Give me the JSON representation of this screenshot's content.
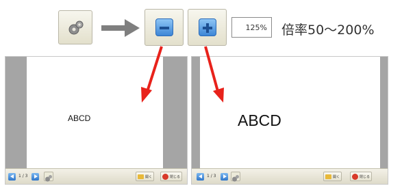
{
  "toolbar": {
    "zoom_value": "125%",
    "zoom_caption": "倍率50～200%"
  },
  "icons": {
    "settings": "gear-icon",
    "arrow": "arrow-right-icon",
    "zoom_out": "minus-icon",
    "zoom_in": "plus-icon",
    "pointers": "red-arrow-icon"
  },
  "preview_small": {
    "text": "ABCD",
    "page_indicator": "1 / 3",
    "open_label": "開く",
    "close_label": "閉じる"
  },
  "preview_large": {
    "text": "ABCD",
    "page_indicator": "1 / 3",
    "open_label": "開く",
    "close_label": "閉じる"
  },
  "colors": {
    "pointer_red": "#e8221b",
    "gray_arrow": "#7f7f7f",
    "button_blue": "#3d86d6"
  }
}
